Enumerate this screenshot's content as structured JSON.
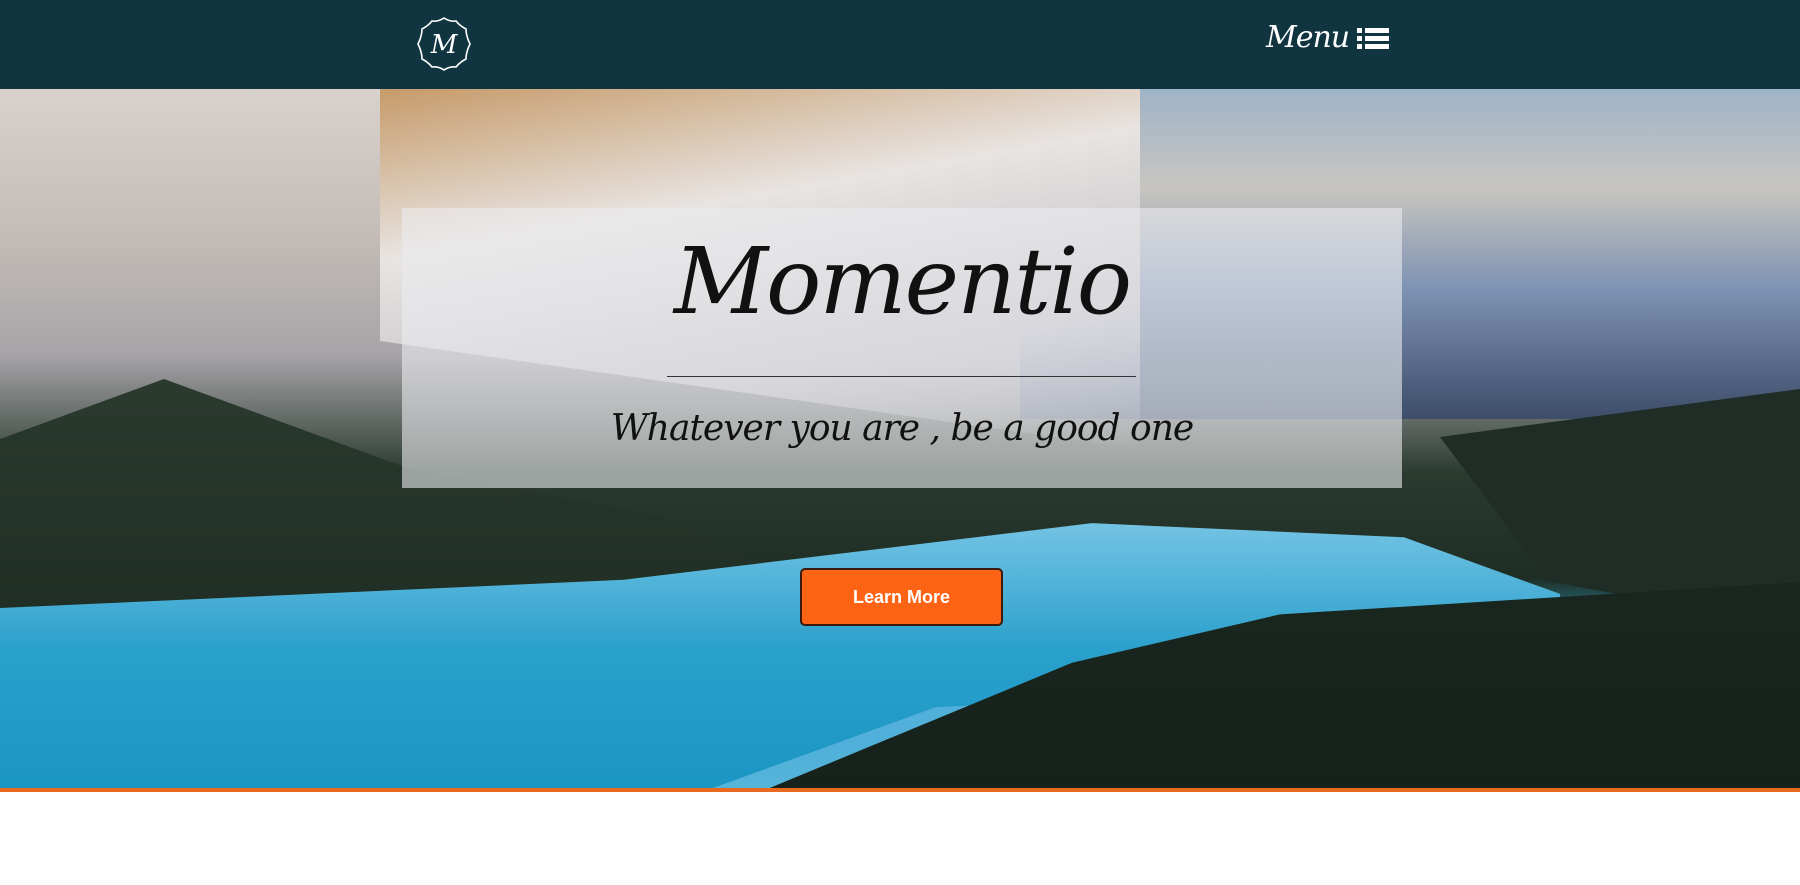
{
  "header": {
    "logo_letter": "M",
    "menu_label": "Menu",
    "menu_icon": "list-icon",
    "background": "#113540"
  },
  "hero": {
    "title": "Momentio",
    "subtitle": "Whatever you are , be a good one",
    "cta_label": "Learn More",
    "cta_color": "#fd6314",
    "accent_border": "#e8691f"
  }
}
